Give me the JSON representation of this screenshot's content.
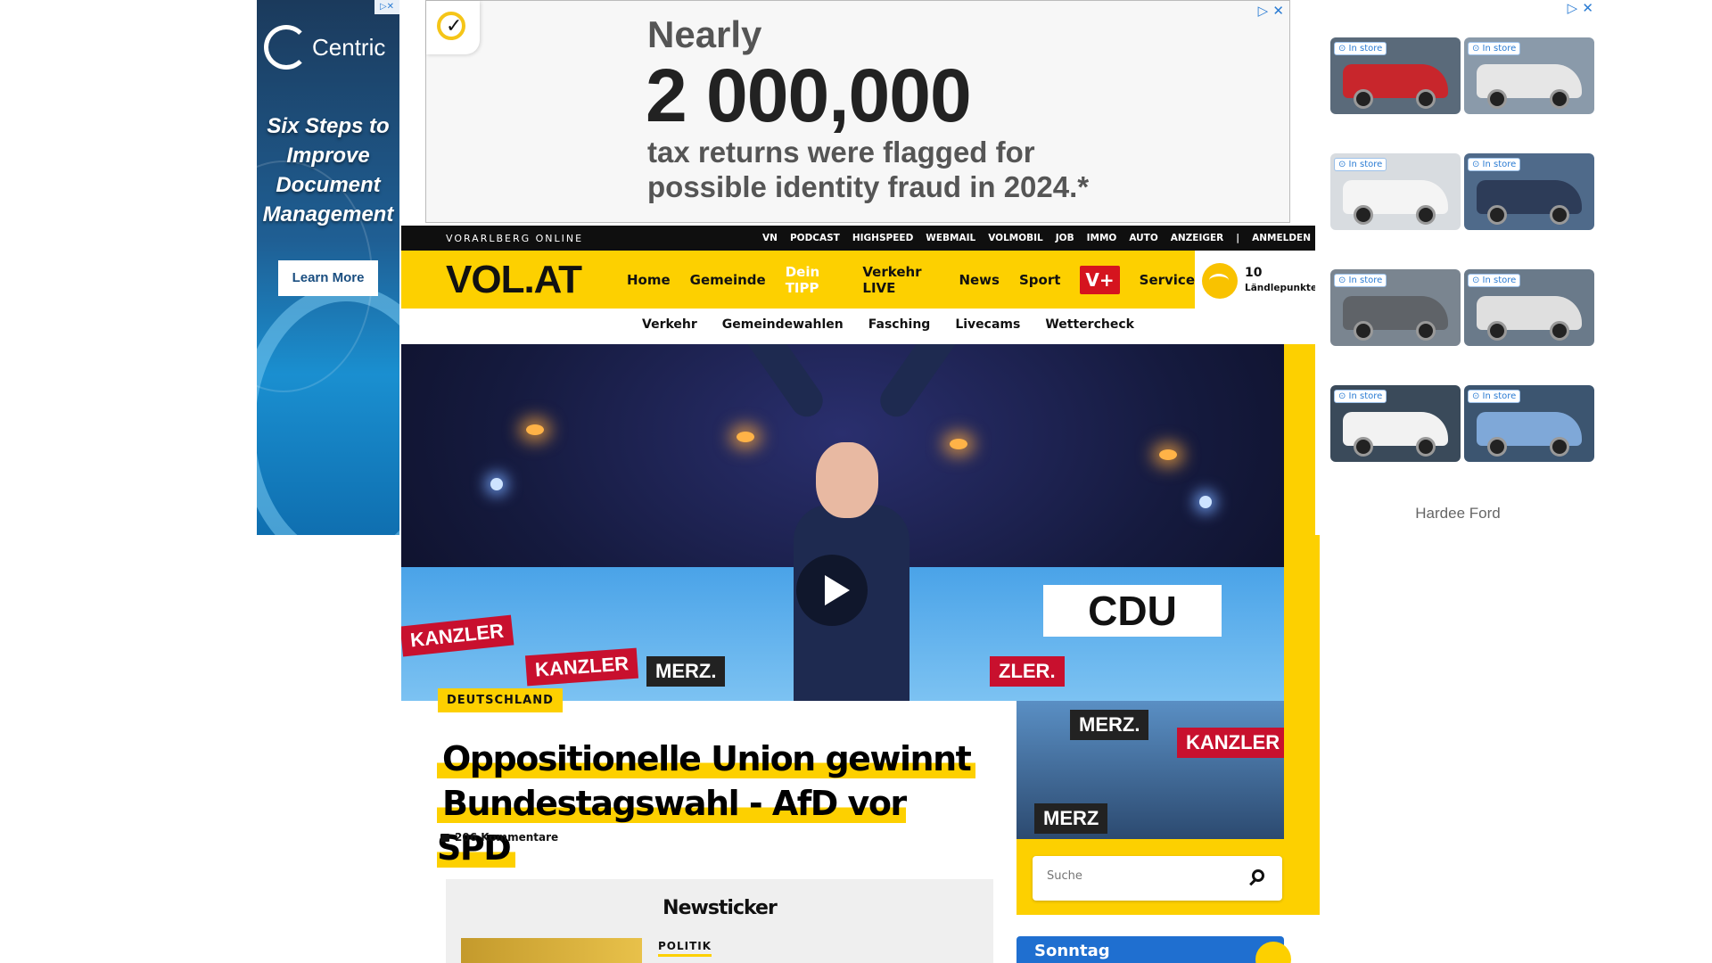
{
  "left_ad": {
    "brand": "Centric",
    "headline": "Six Steps to Improve Document Management",
    "cta": "Learn More",
    "adchoices": "▷✕"
  },
  "top_ad": {
    "line1": "Nearly",
    "line2": "2 000,000",
    "line3": "tax returns were flagged for possible identity fraud in 2024.*",
    "icons": "▷ ✕"
  },
  "navstrip": {
    "brand": "VORARLBERG ONLINE",
    "links": [
      "VN",
      "PODCAST",
      "HIGHSPEED",
      "WEBMAIL",
      "VOLMOBIL",
      "JOB",
      "IMMO",
      "AUTO",
      "ANZEIGER",
      "|",
      "ANMELDEN"
    ]
  },
  "header": {
    "logo": "VOL.AT",
    "nav": [
      "Home",
      "Gemeinde",
      "Dein TIPP",
      "Verkehr LIVE",
      "News",
      "Sport"
    ],
    "vplus": "V+",
    "service": "Service",
    "points_value": "10",
    "points_label": "Ländlepunkte"
  },
  "subnav": [
    "Verkehr",
    "Gemeindewahlen",
    "Fasching",
    "Livecams",
    "Wettercheck"
  ],
  "hero": {
    "signs": [
      "KANZLER",
      "KANZLER",
      "MERZ.",
      "ZLER.",
      "CDU",
      "MERZ.",
      "KANZLER",
      "MERZ"
    ]
  },
  "article": {
    "tag": "DEUTSCHLAND",
    "headline_line1": "Oppositionelle Union gewinnt",
    "headline_line2": "Bundestagswahl - AfD vor SPD",
    "comments": "206 Kommentare"
  },
  "newsticker": {
    "title": "Newsticker",
    "category": "POLITIK"
  },
  "search": {
    "placeholder": "Suche"
  },
  "weather": {
    "day": "Sonntag"
  },
  "right_ad": {
    "icons": "▷ ✕",
    "badge": "In store",
    "advertiser": "Hardee Ford",
    "trucks": [
      {
        "color": "#c8262c",
        "bg": "#5a6a7a"
      },
      {
        "color": "#e6e6e6",
        "bg": "#8a9aaa"
      },
      {
        "color": "#f4f4f4",
        "bg": "#d8dce0"
      },
      {
        "color": "#2d3c58",
        "bg": "#4f6a8a"
      },
      {
        "color": "#5f6368",
        "bg": "#7a8590"
      },
      {
        "color": "#dfdfdf",
        "bg": "#6a7a8a"
      },
      {
        "color": "#f2f2f2",
        "bg": "#3a4a5a"
      },
      {
        "color": "#7fa8d8",
        "bg": "#3c5570"
      }
    ]
  },
  "colors": {
    "brand_yellow": "#fdd000",
    "vplus_red": "#d5141e",
    "nav_black": "#0f0f0f"
  }
}
